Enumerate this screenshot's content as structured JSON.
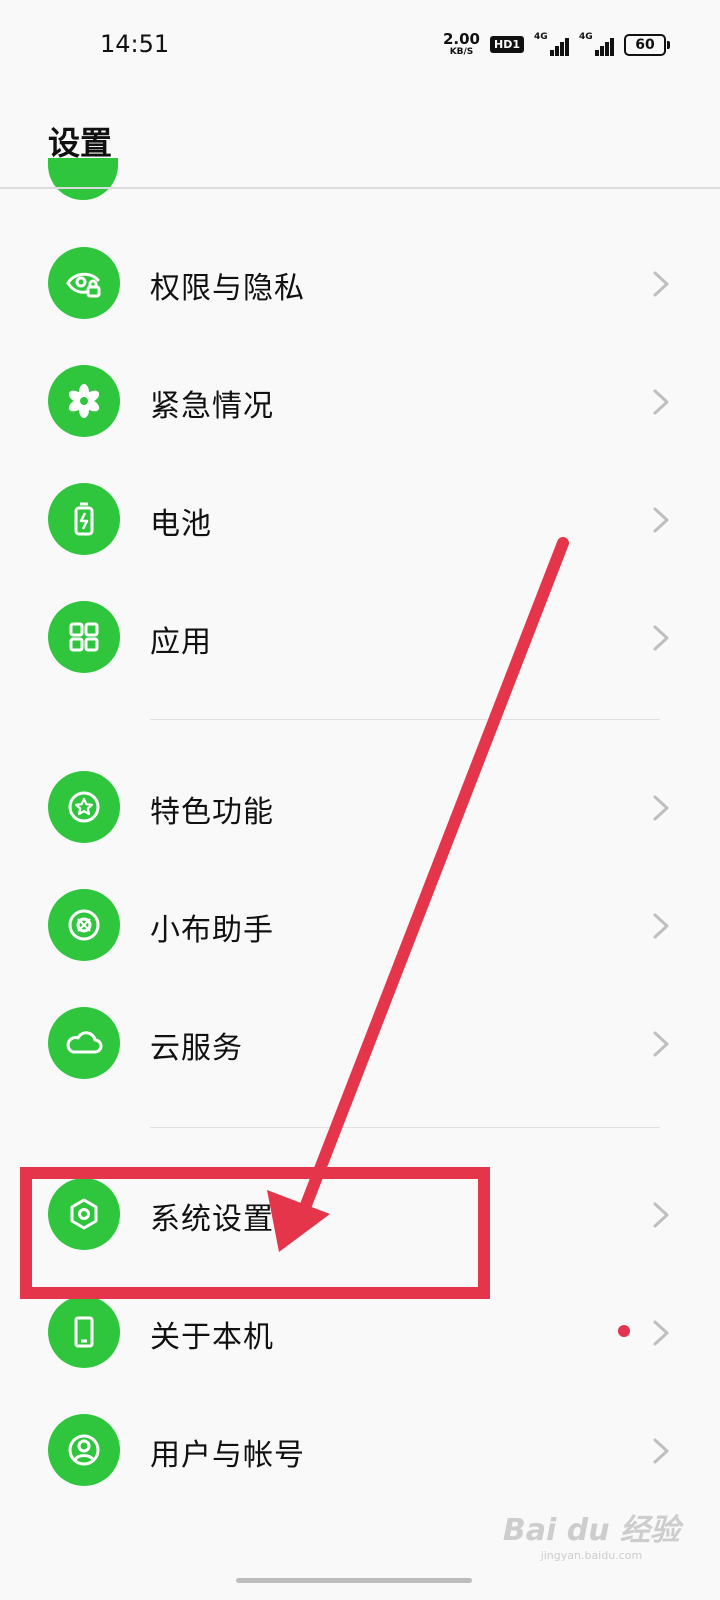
{
  "status_bar": {
    "time": "14:51",
    "net_speed_value": "2.00",
    "net_speed_unit": "KB/S",
    "hd_label": "HD1",
    "signal1_label": "4G",
    "signal2_label": "4G",
    "battery_level": "60"
  },
  "header": {
    "title": "设置"
  },
  "settings": {
    "items": [
      {
        "label": "权限与隐私",
        "icon": "eye-lock-icon"
      },
      {
        "label": "紧急情况",
        "icon": "asterisk-icon"
      },
      {
        "label": "电池",
        "icon": "battery-icon"
      },
      {
        "label": "应用",
        "icon": "grid-icon"
      },
      {
        "label": "特色功能",
        "icon": "star-circle-icon"
      },
      {
        "label": "小布助手",
        "icon": "assistant-icon"
      },
      {
        "label": "云服务",
        "icon": "cloud-icon"
      },
      {
        "label": "系统设置",
        "icon": "hexagon-settings-icon"
      },
      {
        "label": "关于本机",
        "icon": "phone-icon",
        "badge": true
      },
      {
        "label": "用户与帐号",
        "icon": "user-circle-icon"
      }
    ]
  },
  "annotation": {
    "color": "#e5354a"
  },
  "accent": {
    "icon_bg": "#2fc53d",
    "badge": "#e23350"
  },
  "watermark": {
    "logo": "Bai du 经验",
    "sub": "jingyan.baidu.com"
  }
}
